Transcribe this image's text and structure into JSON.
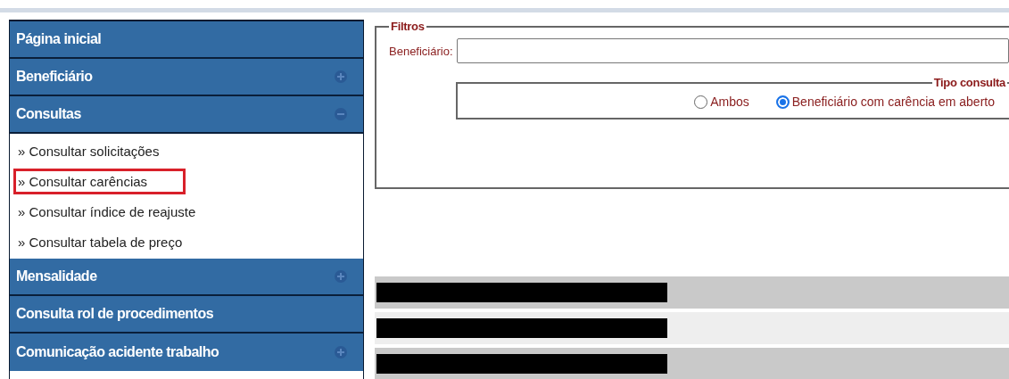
{
  "sidebar": {
    "items": [
      {
        "label": "Página inicial",
        "kind": "header",
        "expandable": false
      },
      {
        "label": "Beneficiário",
        "kind": "header",
        "expanded": false,
        "expandable": true
      },
      {
        "label": "Consultas",
        "kind": "header",
        "expanded": true,
        "expandable": true,
        "children": [
          {
            "label": "» Consultar solicitações",
            "highlighted": false
          },
          {
            "label": "» Consultar carências",
            "highlighted": true
          },
          {
            "label": "» Consultar índice de reajuste",
            "highlighted": false
          },
          {
            "label": "» Consultar tabela de preço",
            "highlighted": false
          }
        ]
      },
      {
        "label": "Mensalidade",
        "kind": "header",
        "expanded": false,
        "expandable": true
      },
      {
        "label": "Consulta rol de procedimentos",
        "kind": "header",
        "expandable": false
      },
      {
        "label": "Comunicação acidente trabalho",
        "kind": "header",
        "expanded": false,
        "expandable": true
      }
    ]
  },
  "filters": {
    "legend": "Filtros",
    "beneficiary_label": "Beneficiário:",
    "query_type": {
      "legend": "Tipo consulta",
      "options": [
        {
          "label": "Ambos",
          "selected": false
        },
        {
          "label": "Beneficiário com carência em aberto",
          "selected": true
        }
      ]
    }
  },
  "results": {
    "rows": [
      {
        "redacted": true,
        "striped": true
      },
      {
        "redacted": true,
        "striped": false
      },
      {
        "redacted": true,
        "striped": true
      }
    ]
  }
}
